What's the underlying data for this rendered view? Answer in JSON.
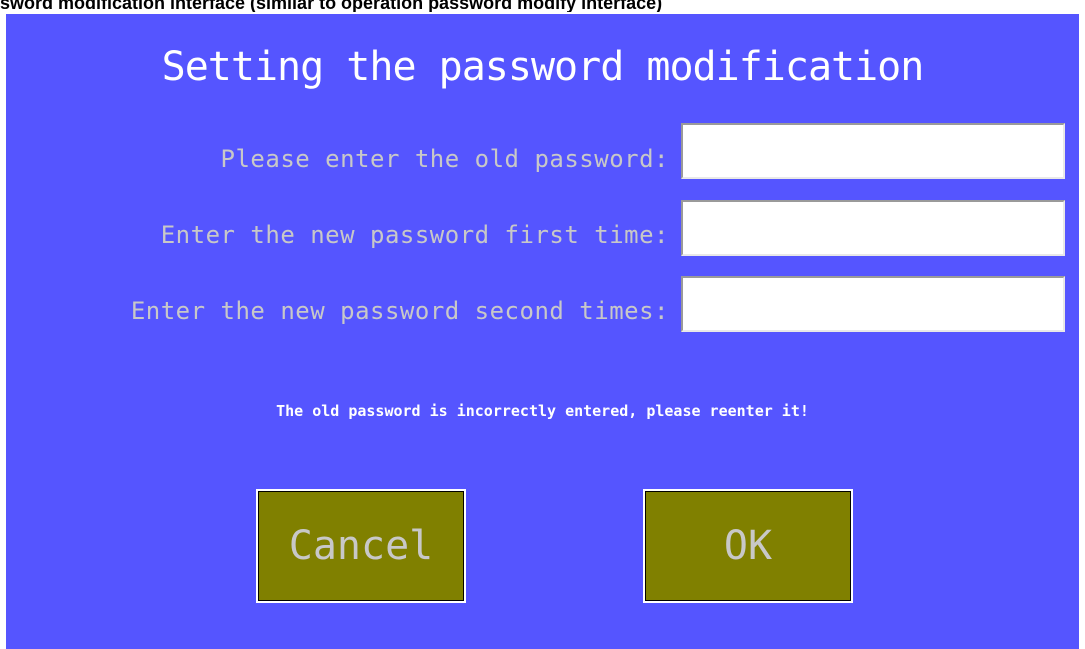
{
  "caption": "sword modification interface (similar to operation password modify interface)",
  "dialog": {
    "title": "Setting the password modification",
    "fields": [
      {
        "label": "Please enter the old password:",
        "value": ""
      },
      {
        "label": "Enter the new password first time:",
        "value": ""
      },
      {
        "label": "Enter the new password second times:",
        "value": ""
      }
    ],
    "message": "The old password is incorrectly entered, please reenter it!",
    "cancel_label": "Cancel",
    "ok_label": "OK"
  },
  "colors": {
    "background": "#5555ff",
    "button": "#808000",
    "label_text": "#c8c8c8",
    "title_text": "#ffffff"
  }
}
